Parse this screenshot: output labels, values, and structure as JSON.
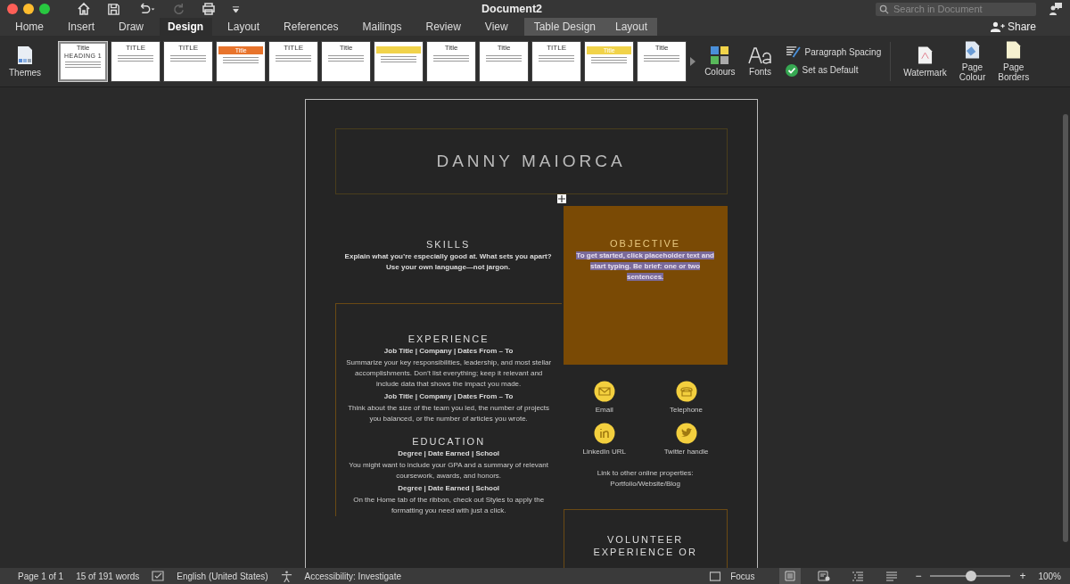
{
  "window": {
    "title": "Document2",
    "search": {
      "placeholder": "Search in Document"
    }
  },
  "tabs": [
    {
      "label": "Home",
      "selected": false,
      "kind": "normal"
    },
    {
      "label": "Insert",
      "selected": false,
      "kind": "normal"
    },
    {
      "label": "Draw",
      "selected": false,
      "kind": "normal"
    },
    {
      "label": "Design",
      "selected": true,
      "kind": "normal"
    },
    {
      "label": "Layout",
      "selected": false,
      "kind": "normal"
    },
    {
      "label": "References",
      "selected": false,
      "kind": "normal"
    },
    {
      "label": "Mailings",
      "selected": false,
      "kind": "normal"
    },
    {
      "label": "Review",
      "selected": false,
      "kind": "normal"
    },
    {
      "label": "View",
      "selected": false,
      "kind": "normal"
    },
    {
      "label": "Table Design",
      "selected": false,
      "kind": "contextual"
    },
    {
      "label": "Layout",
      "selected": false,
      "kind": "contextual"
    }
  ],
  "share": "Share",
  "ribbon": {
    "themes": "Themes",
    "styles": [
      {
        "title": "Title",
        "heading": "HEADING 1",
        "selected": true
      },
      {
        "title": "TITLE",
        "selected": false
      },
      {
        "title": "TITLE",
        "selected": false
      },
      {
        "title": "Title",
        "selected": false,
        "color": "#e8742c"
      },
      {
        "title": "TITLE",
        "selected": false
      },
      {
        "title": "Title",
        "selected": false
      },
      {
        "selected": false,
        "color": "#f1d34a"
      },
      {
        "title": "Title",
        "selected": false
      },
      {
        "title": "Title",
        "selected": false
      },
      {
        "title": "TITLE",
        "selected": false
      },
      {
        "title": "Title",
        "selected": false,
        "color": "#f1d34a"
      },
      {
        "title": "Title",
        "selected": false
      }
    ],
    "colours": "Colours",
    "fonts": "Fonts",
    "paragraph_spacing": "Paragraph Spacing",
    "set_as_default": "Set as Default",
    "watermark": "Watermark",
    "page_colour": [
      "Page",
      "Colour"
    ],
    "page_borders": [
      "Page",
      "Borders"
    ]
  },
  "document": {
    "name": "DANNY MAIORCA",
    "skills": {
      "heading": "SKILLS",
      "text": "Explain what you’re especially good at. What sets you apart? Use your own language—not jargon."
    },
    "objective": {
      "heading": "OBJECTIVE",
      "text": "To get started, click placeholder text and start typing. Be brief: one or two sentences.",
      "text_selected": true
    },
    "experience": {
      "heading": "EXPERIENCE",
      "entries": [
        {
          "title": "Job Title | Company | Dates From – To",
          "text": "Summarize your key responsibilities, leadership, and most stellar accomplishments. Don’t list everything; keep it relevant and include data that shows the impact you made."
        },
        {
          "title": "Job Title | Company | Dates From – To",
          "text": "Think about the size of the team you led, the number of projects you balanced, or the number of articles you wrote."
        }
      ]
    },
    "education": {
      "heading": "EDUCATION",
      "entries": [
        {
          "title": "Degree | Date Earned | School",
          "text": "You might want to include your GPA and a summary of relevant coursework, awards, and honors."
        },
        {
          "title": "Degree | Date Earned | School",
          "text": "On the Home tab of the ribbon, check out Styles to apply the formatting you need with just a click."
        }
      ]
    },
    "contacts": [
      {
        "kind": "email",
        "label": "Email"
      },
      {
        "kind": "phone",
        "label": "Telephone"
      },
      {
        "kind": "linkedin",
        "label": "LinkedIn URL"
      },
      {
        "kind": "twitter",
        "label": "Twitter handle"
      }
    ],
    "links_text": "Link to other online properties: Portfolio/Website/Blog",
    "volunteer_heading": "VOLUNTEER EXPERIENCE OR"
  },
  "status_bar": {
    "page": "Page 1 of 1",
    "words": "15 of 191 words",
    "language": "English (United States)",
    "accessibility": "Accessibility: Investigate",
    "focus": "Focus",
    "views": [
      {
        "kind": "print",
        "selected": true
      },
      {
        "kind": "web",
        "selected": false
      },
      {
        "kind": "outline",
        "selected": false
      },
      {
        "kind": "draft",
        "selected": false
      }
    ],
    "zoom": {
      "out": "−",
      "in": "+",
      "level": 0.51,
      "reading": "100%"
    }
  }
}
